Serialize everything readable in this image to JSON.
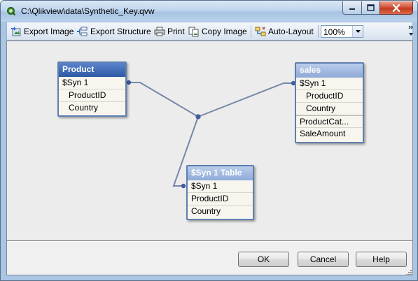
{
  "window": {
    "title": "C:\\Qlikview\\data\\Synthetic_Key.qvw"
  },
  "toolbar": {
    "export_image": "Export Image",
    "export_structure": "Export Structure",
    "print": "Print",
    "copy_image": "Copy Image",
    "auto_layout": "Auto-Layout",
    "zoom": "100%"
  },
  "tables": {
    "product": {
      "name": "Product",
      "fields": [
        "$Syn 1",
        "ProductID",
        "Country"
      ]
    },
    "sales": {
      "name": "sales",
      "fields": [
        "$Syn 1",
        "ProductID",
        "Country",
        "ProductCat...",
        "SaleAmount"
      ]
    },
    "syn_table": {
      "name": "$Syn 1 Table",
      "fields": [
        "$Syn 1",
        "ProductID",
        "Country"
      ]
    }
  },
  "buttons": {
    "ok": "OK",
    "cancel": "Cancel",
    "help": "Help"
  }
}
